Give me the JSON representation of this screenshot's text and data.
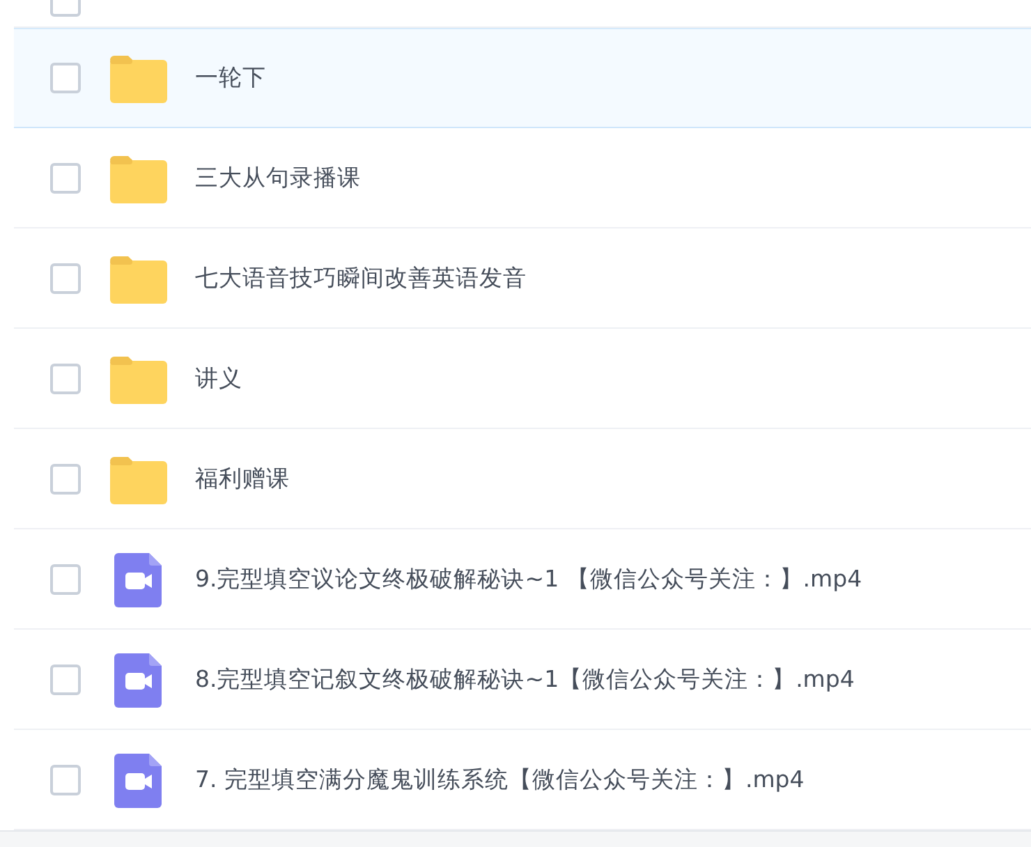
{
  "partial_row": {
    "checked": false
  },
  "files": [
    {
      "kind": "folder",
      "name": "一轮下",
      "checked": false,
      "highlighted": true
    },
    {
      "kind": "folder",
      "name": "三大从句录播课",
      "checked": false,
      "highlighted": false
    },
    {
      "kind": "folder",
      "name": "七大语音技巧瞬间改善英语发音",
      "checked": false,
      "highlighted": false
    },
    {
      "kind": "folder",
      "name": "讲义",
      "checked": false,
      "highlighted": false
    },
    {
      "kind": "folder",
      "name": "福利赠课",
      "checked": false,
      "highlighted": false
    },
    {
      "kind": "video",
      "name": "9.完型填空议论文终极破解秘诀~1 【微信公众号关注：】.mp4",
      "checked": false,
      "highlighted": false
    },
    {
      "kind": "video",
      "name": "8.完型填空记叙文终极破解秘诀~1【微信公众号关注：】.mp4",
      "checked": false,
      "highlighted": false
    },
    {
      "kind": "video",
      "name": "7. 完型填空满分魔鬼训练系统【微信公众号关注：】.mp4",
      "checked": false,
      "highlighted": false
    }
  ]
}
